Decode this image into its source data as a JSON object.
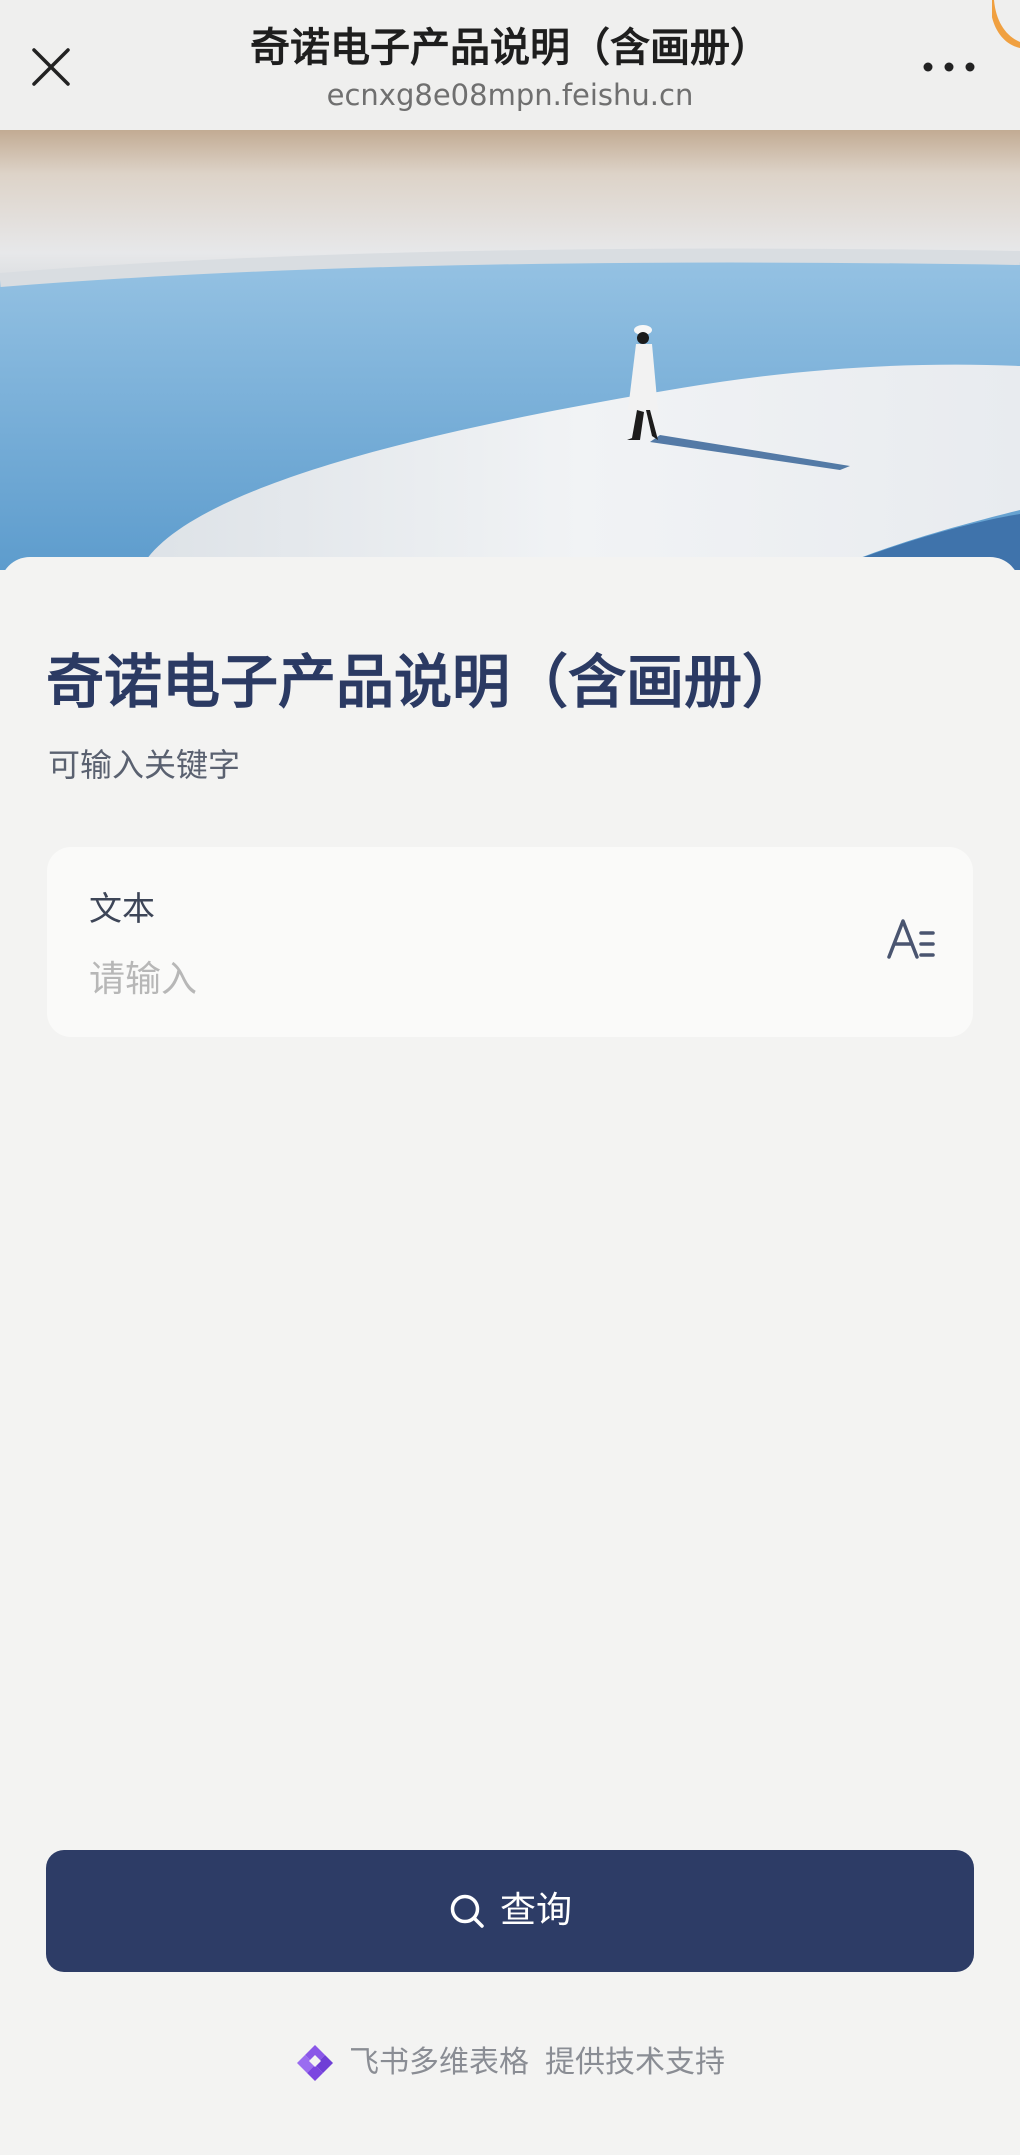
{
  "navbar": {
    "title": "奇诺电子产品说明（含画册）",
    "url": "ecnxg8e08mpn.feishu.cn",
    "close_icon": "close-icon",
    "more_icon": "more-icon"
  },
  "form": {
    "title": "奇诺电子产品说明（含画册）",
    "description": "可输入关键字",
    "field": {
      "label": "文本",
      "placeholder": "请输入",
      "value": "",
      "type_icon": "text-type-icon"
    },
    "submit": {
      "label": "查询",
      "icon": "search-icon"
    }
  },
  "footer": {
    "brand": "飞书多维表格",
    "support_text": "提供技术支持",
    "logo_icon": "feishu-bitable-logo-icon"
  },
  "colors": {
    "primary": "#2d3c66",
    "title": "#2b3a63",
    "background": "#f3f3f2",
    "field_background": "#fafaf9",
    "placeholder": "#b7b7b7",
    "logo": "#7b45e0"
  }
}
